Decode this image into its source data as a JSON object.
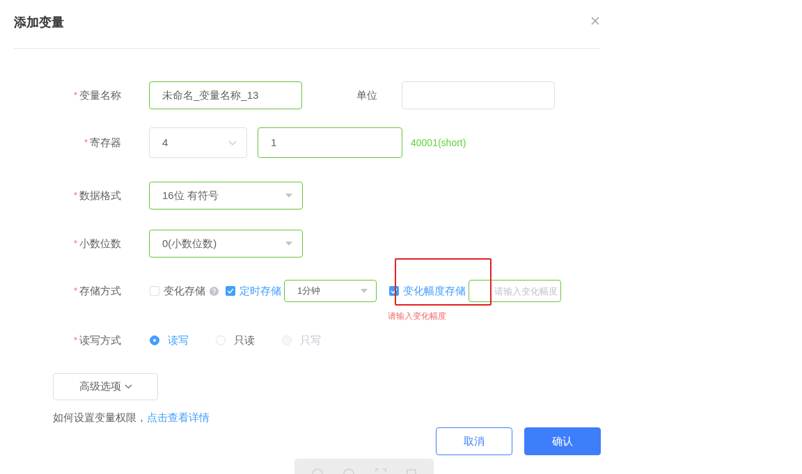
{
  "dialog": {
    "title": "添加变量",
    "rows": [
      {
        "kind": "text",
        "label": "变量名称",
        "required": "*",
        "value": "未命名_变量名称_13",
        "validated": true,
        "side_label": "单位"
      },
      {
        "kind": "register",
        "label": "寄存器",
        "required": "*",
        "area": "4",
        "address": "1",
        "validated": true,
        "hint": "40001(short)"
      },
      {
        "kind": "select",
        "label": "数据格式",
        "required": "*",
        "value": "16位 有符号",
        "validated": true
      },
      {
        "kind": "select",
        "label": "小数位数",
        "required": "*",
        "value": "0(小数位数)",
        "validated": true
      },
      {
        "kind": "storage",
        "label": "存储方式",
        "required": "*",
        "options": [
          {
            "label": "变化存储",
            "checked": false,
            "help": true
          },
          {
            "label": "定时存储",
            "checked": true,
            "interval": "1分钟"
          },
          {
            "label": "变化幅度存储",
            "checked": true,
            "placeholder": "请输入变化幅度",
            "error": "请输入变化幅度"
          }
        ]
      },
      {
        "kind": "radio",
        "label": "读写方式",
        "required": "*",
        "options": [
          {
            "label": "读写",
            "selected": true,
            "disabled": false
          },
          {
            "label": "只读",
            "selected": false,
            "disabled": false
          },
          {
            "label": "只写",
            "selected": false,
            "disabled": true
          }
        ]
      }
    ],
    "advanced": "高级选项",
    "help_text": "如何设置变量权限，",
    "help_link": "点击查看详情",
    "buttons": [
      {
        "label": "取消",
        "primary": false
      },
      {
        "label": "确认",
        "primary": true
      }
    ]
  }
}
